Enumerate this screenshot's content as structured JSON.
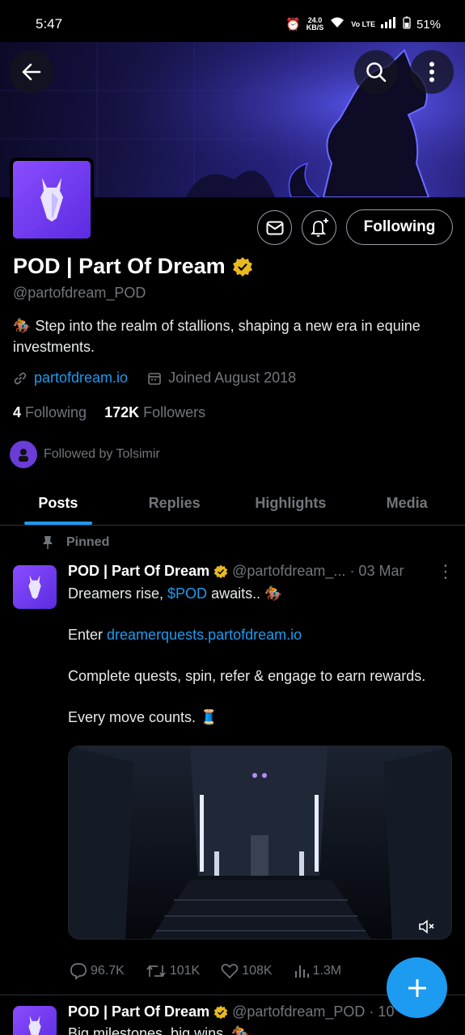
{
  "status": {
    "time": "5:47",
    "net_speed": "24.0",
    "net_unit": "KB/S",
    "volte": "Vo LTE",
    "battery": "51%"
  },
  "profile": {
    "name": "POD | Part Of Dream",
    "handle": "@partofdream_POD",
    "bio_emoji": "🏇",
    "bio": "Step into the realm of stallions, shaping a new era in equine investments.",
    "website": "partofdream.io",
    "joined": "Joined August 2018",
    "following_count": "4",
    "following_label": "Following",
    "followers_count": "172K",
    "followers_label": "Followers",
    "followed_by": "Followed by Tolsimir",
    "follow_button": "Following"
  },
  "tabs": [
    "Posts",
    "Replies",
    "Highlights",
    "Media"
  ],
  "pinned_label": "Pinned",
  "post1": {
    "name": "POD | Part Of Dream",
    "handle": "@partofdream_...",
    "date": "· 03 Mar",
    "line1_prefix": "Dreamers rise, ",
    "line1_link": "$POD",
    "line1_suffix": " awaits.. 🏇",
    "line2_prefix": "Enter ",
    "line2_link": "dreamerquests.partofdream.io",
    "line3": "Complete quests, spin, refer & engage to earn rewards.",
    "line4": "Every move counts. 🧵",
    "replies": "96.7K",
    "reposts": "101K",
    "likes": "108K",
    "views": "1.3M"
  },
  "post2": {
    "name": "POD | Part Of Dream",
    "handle": "@partofdream_POD",
    "date": "· 10",
    "text": "Big milestones, big wins. 🏇"
  },
  "colors": {
    "accent": "#1d9bf0",
    "avatar": "#7a3ff2",
    "verified": "#e8b923"
  }
}
